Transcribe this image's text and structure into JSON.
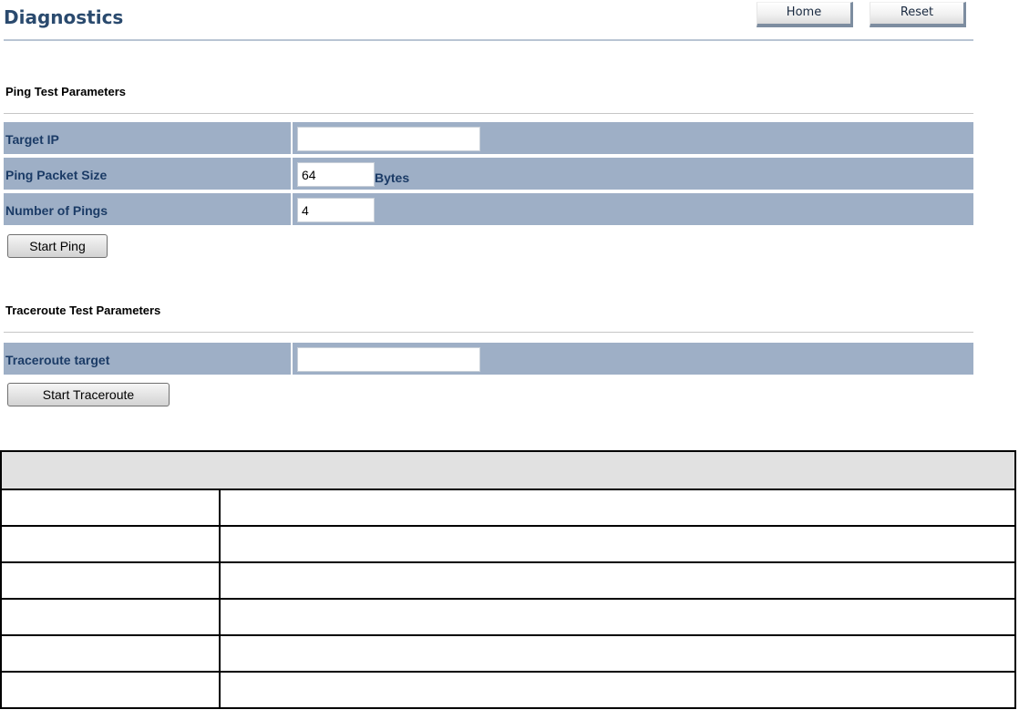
{
  "header": {
    "title": "Diagnostics",
    "home_label": "Home",
    "reset_label": "Reset"
  },
  "ping": {
    "section_title": "Ping Test Parameters",
    "rows": [
      {
        "label": "Target IP",
        "value": ""
      },
      {
        "label": "Ping Packet Size",
        "value": "64",
        "unit": "Bytes"
      },
      {
        "label": "Number of Pings",
        "value": "4"
      }
    ],
    "start_label": "Start Ping"
  },
  "traceroute": {
    "section_title": "Traceroute Test Parameters",
    "rows": [
      {
        "label": "Traceroute target",
        "value": ""
      }
    ],
    "start_label": "Start Traceroute"
  },
  "colors": {
    "title": "#2a4a6e",
    "row_background": "#9eafc6",
    "row_label": "#1b3b66",
    "result_header": "#e1e1e1"
  }
}
